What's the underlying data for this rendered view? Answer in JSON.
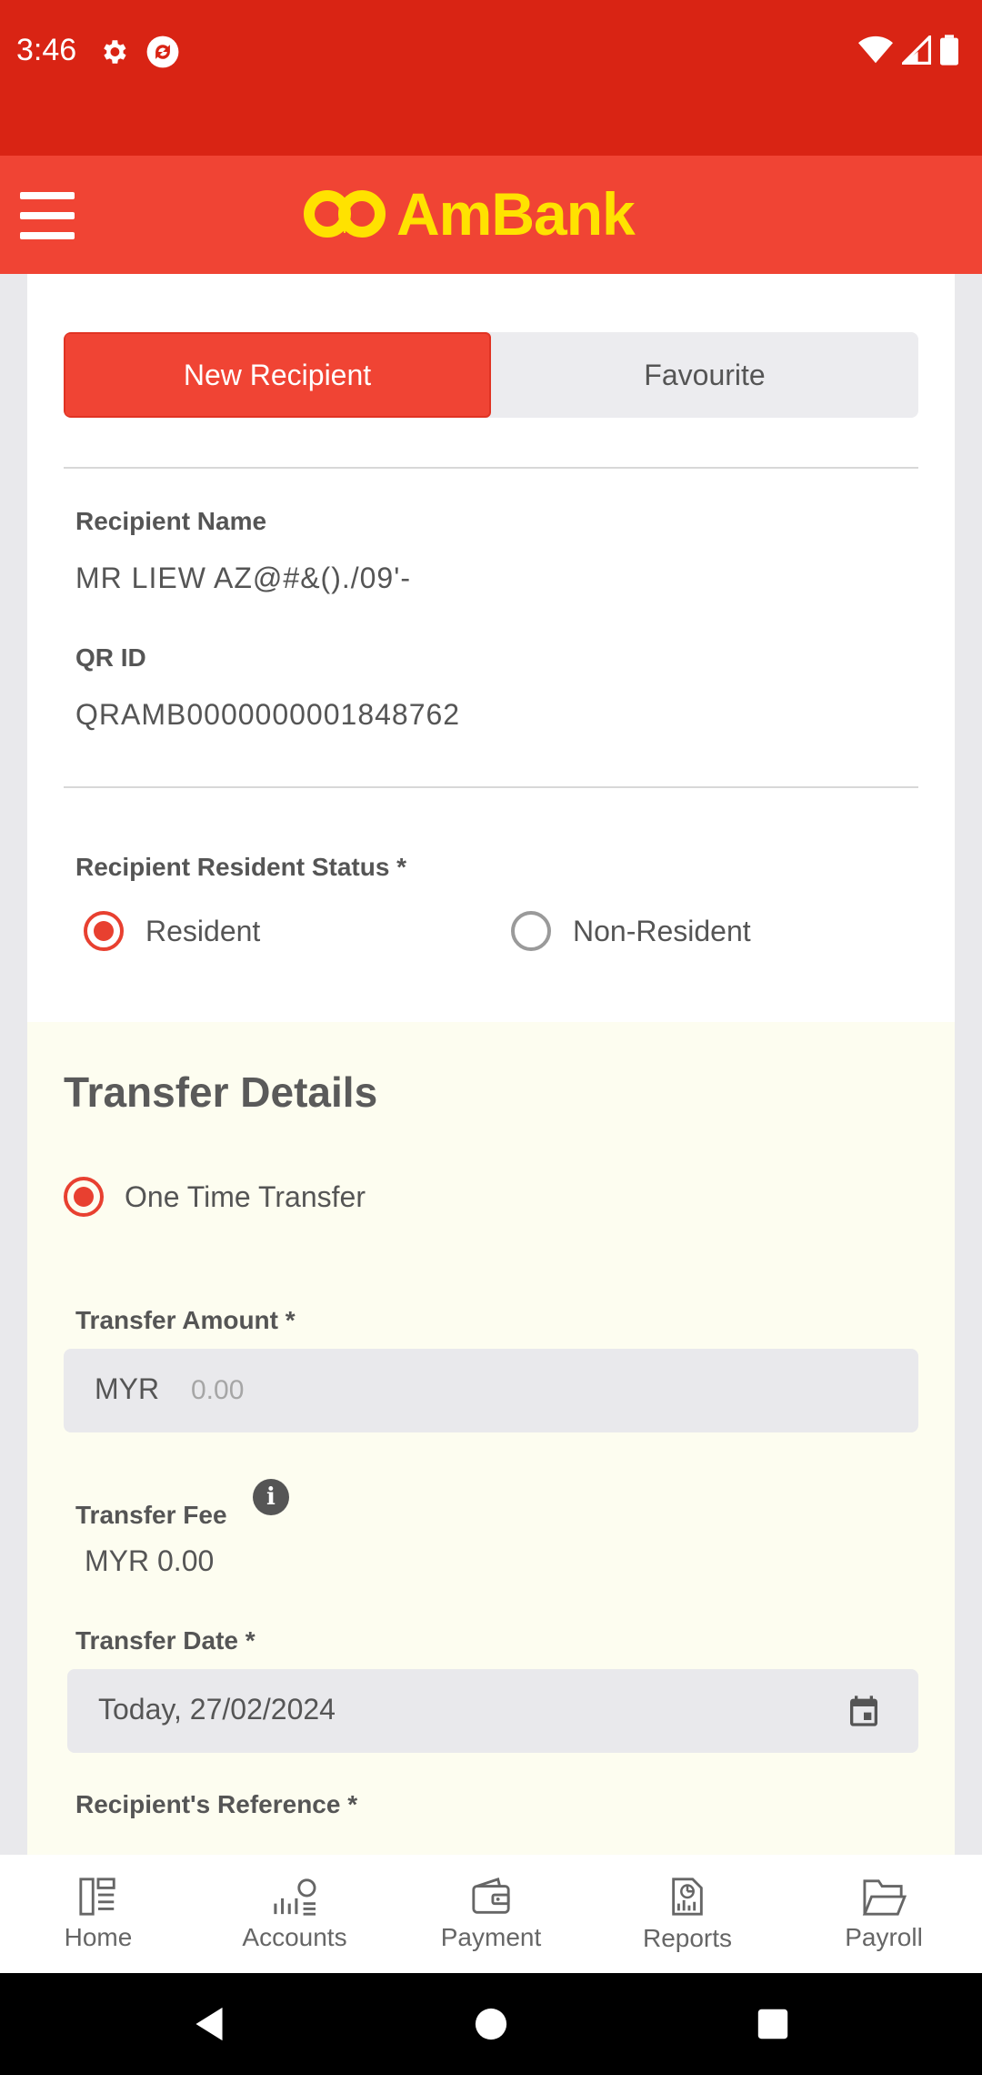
{
  "status_bar": {
    "time": "3:46",
    "icons_left": [
      "gear-icon",
      "sync-icon"
    ],
    "icons_right": [
      "wifi-icon",
      "signal-icon",
      "battery-icon"
    ]
  },
  "header": {
    "logo_text": "AmBank",
    "brand_color": "#f04434",
    "logo_color": "#ffe200"
  },
  "tabs": [
    {
      "label": "New Recipient",
      "active": true
    },
    {
      "label": "Favourite",
      "active": false
    }
  ],
  "recipient": {
    "name_label": "Recipient Name",
    "name_value": "MR LIEW AZ@#&()./09'-",
    "qr_label": "QR ID",
    "qr_value": "QRAMB0000000001848762"
  },
  "resident_status": {
    "label": "Recipient Resident Status *",
    "options": [
      {
        "label": "Resident",
        "selected": true
      },
      {
        "label": "Non-Resident",
        "selected": false
      }
    ]
  },
  "transfer": {
    "title": "Transfer Details",
    "type_label": "One Time Transfer",
    "amount_label": "Transfer Amount *",
    "amount_prefix": "MYR",
    "amount_placeholder": "0.00",
    "fee_label": "Transfer Fee",
    "fee_value": "MYR 0.00",
    "date_label": "Transfer Date *",
    "date_value": "Today, 27/02/2024",
    "reference_label": "Recipient's Reference *"
  },
  "bottom_nav": [
    {
      "label": "Home",
      "icon": "home-icon"
    },
    {
      "label": "Accounts",
      "icon": "accounts-icon"
    },
    {
      "label": "Payment",
      "icon": "wallet-icon"
    },
    {
      "label": "Reports",
      "icon": "reports-icon"
    },
    {
      "label": "Payroll",
      "icon": "folder-icon"
    }
  ]
}
